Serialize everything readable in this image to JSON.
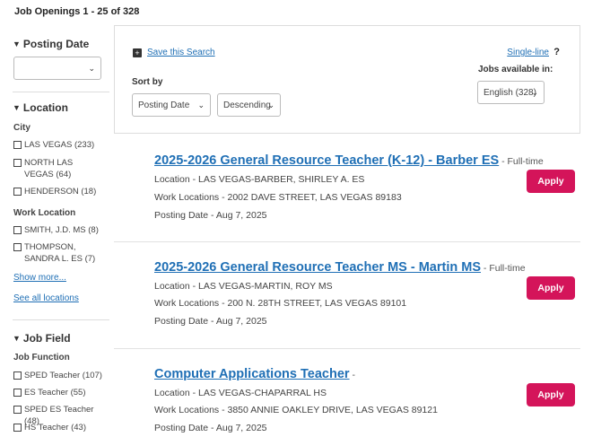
{
  "results": {
    "count_label": "Job Openings 1 - 25 of 328"
  },
  "sidebar": {
    "posting_date": {
      "heading": "Posting Date",
      "value": ""
    },
    "location": {
      "heading": "Location",
      "city_label": "City",
      "cities": [
        {
          "name": "LAS VEGAS",
          "count": "(233)"
        },
        {
          "name": "NORTH LAS VEGAS",
          "count": "(64)"
        },
        {
          "name": "HENDERSON",
          "count": "(18)"
        }
      ],
      "work_location_label": "Work Location",
      "work_locations": [
        {
          "name": "SMITH, J.D. MS",
          "count": "(8)"
        },
        {
          "name": "THOMPSON, SANDRA L. ES",
          "count": "(7)"
        }
      ],
      "show_more": "Show more...",
      "see_all": "See all locations"
    },
    "job_field": {
      "heading": "Job Field",
      "function_label": "Job Function",
      "functions": [
        {
          "name": "SPED Teacher",
          "count": "(107)"
        },
        {
          "name": "ES Teacher",
          "count": "(55)"
        },
        {
          "name": "SPED ES Teacher",
          "count": "(48)"
        },
        {
          "name": "HS Teacher",
          "count": "(43)"
        }
      ]
    }
  },
  "search_panel": {
    "save_search": "Save this Search",
    "single_line": "Single-line",
    "help": "?",
    "sort_by_label": "Sort by",
    "sort_field": "Posting Date",
    "sort_order": "Descending",
    "jobs_available_label": "Jobs available in:",
    "language": "English (328)"
  },
  "jobs": [
    {
      "title": "2025-2026 General Resource Teacher (K-12) - Barber ES",
      "type": " - Full-time",
      "location": "Location - LAS VEGAS-BARBER, SHIRLEY A. ES",
      "work_locations": "Work Locations - 2002 DAVE STREET, LAS VEGAS 89183",
      "posting_date": "Posting Date - Aug 7, 2025",
      "apply": "Apply"
    },
    {
      "title": "2025-2026 General Resource Teacher MS - Martin MS",
      "type": " - Full-time",
      "location": "Location - LAS VEGAS-MARTIN, ROY MS",
      "work_locations": "Work Locations - 200 N. 28TH STREET, LAS VEGAS 89101",
      "posting_date": "Posting Date - Aug 7, 2025",
      "apply": "Apply"
    },
    {
      "title": "Computer Applications Teacher",
      "type": " -",
      "location": "Location - LAS VEGAS-CHAPARRAL HS",
      "work_locations": "Work Locations - 3850 ANNIE OAKLEY DRIVE, LAS VEGAS 89121",
      "posting_date": "Posting Date - Aug 7, 2025",
      "apply": "Apply"
    }
  ]
}
